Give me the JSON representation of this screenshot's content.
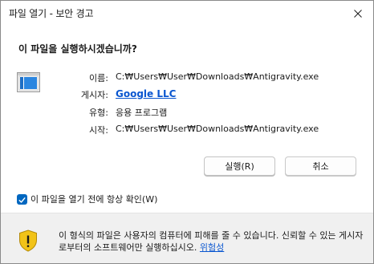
{
  "window": {
    "title": "파일 열기 - 보안 경고",
    "close_glyph": "✕"
  },
  "dialog": {
    "heading": "이 파일을 실행하시겠습니까?",
    "fields": {
      "name_label": "이름:",
      "name_value": "C:₩Users₩User₩Downloads₩Antigravity.exe",
      "publisher_label": "게시자:",
      "publisher_value": "Google LLC",
      "type_label": "유형:",
      "type_value": "응용 프로그램",
      "from_label": "시작:",
      "from_value": "C:₩Users₩User₩Downloads₩Antigravity.exe"
    },
    "buttons": {
      "run_label": "실행(R)",
      "cancel_label": "취소"
    },
    "checkbox": {
      "label": "이 파일을 열기 전에 항상 확인(W)",
      "checked": true
    }
  },
  "footer": {
    "warning_text": "이 형식의 파일은 사용자의 컴퓨터에 피해를 줄 수 있습니다. 신뢰할 수 있는 게시자로부터의 소프트웨어만 실행하십시오.",
    "risk_link": "위험성"
  },
  "colors": {
    "accent": "#0067c0",
    "link": "#0b57d0",
    "shield": "#f2c318",
    "footer_bg": "#f0f0f0"
  },
  "icons": {
    "close": "close-icon",
    "app": "application-window-icon",
    "checkbox": "checkmark-icon",
    "shield": "warning-shield-icon"
  }
}
